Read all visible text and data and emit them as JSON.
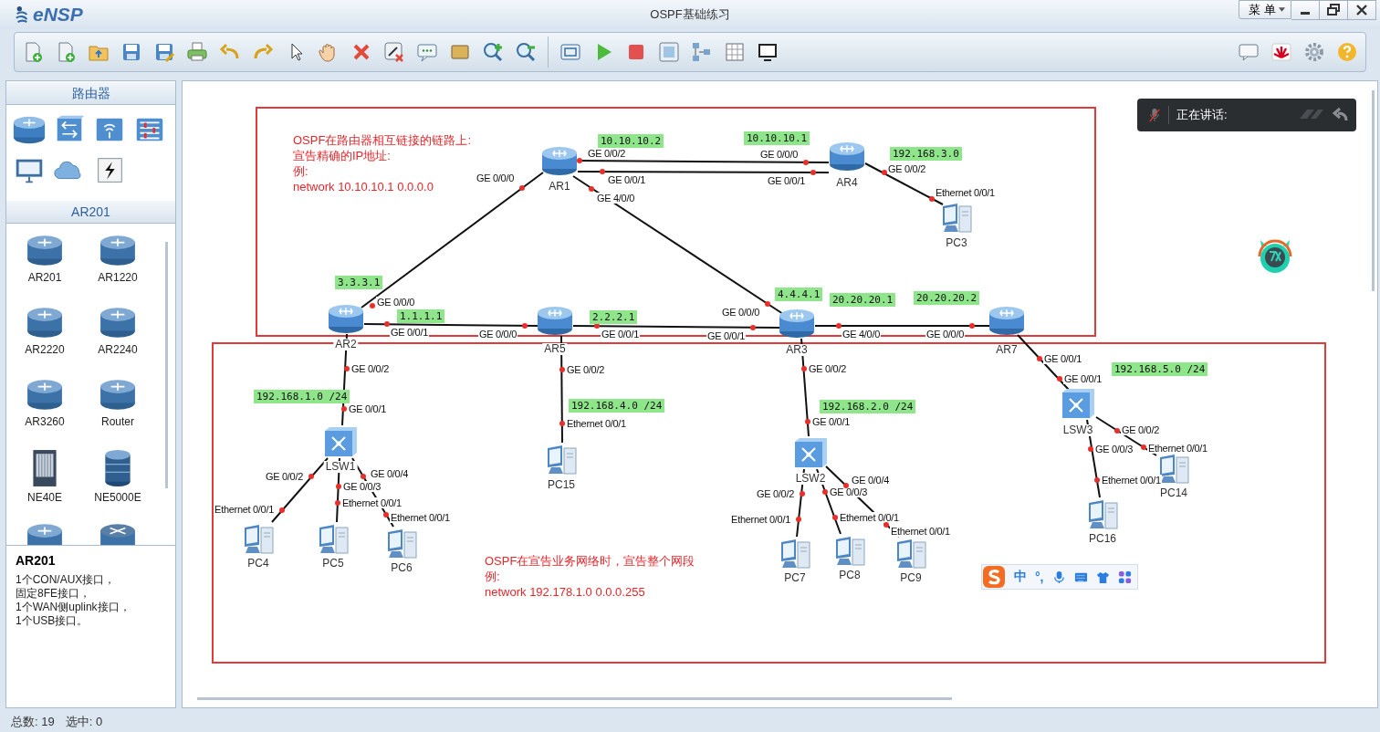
{
  "window": {
    "app": "eNSP",
    "title": "OSPF基础练习",
    "menu": "菜 单"
  },
  "sidebar": {
    "category": "路由器",
    "model": "AR201",
    "devices": [
      {
        "label": "AR201",
        "kind": "router"
      },
      {
        "label": "AR1220",
        "kind": "router"
      },
      {
        "label": "AR2220",
        "kind": "router"
      },
      {
        "label": "AR2240",
        "kind": "router"
      },
      {
        "label": "AR3260",
        "kind": "router"
      },
      {
        "label": "Router",
        "kind": "router"
      },
      {
        "label": "NE40E",
        "kind": "chassis"
      },
      {
        "label": "NE5000E",
        "kind": "core"
      }
    ],
    "info": {
      "title": "AR201",
      "lines": [
        "1个CON/AUX接口，",
        "固定8FE接口，",
        "1个WAN侧uplink接口，",
        "1个USB接口。"
      ]
    }
  },
  "canvas": {
    "notes": [
      {
        "lines": [
          "OSPF在路由器相互链接的链路上:",
          "宣告精确的IP地址:",
          "例:",
          "network 10.10.10.1 0.0.0.0"
        ]
      },
      {
        "lines": [
          "OSPF在宣告业务网络时，宣告整个网段",
          "例:",
          "network 192.178.1.0 0.0.0.255"
        ]
      }
    ],
    "nodes": [
      {
        "label": "AR1",
        "kind": "router"
      },
      {
        "label": "AR4",
        "kind": "router"
      },
      {
        "label": "PC3",
        "kind": "pc"
      },
      {
        "label": "AR2",
        "kind": "router"
      },
      {
        "label": "AR5",
        "kind": "router"
      },
      {
        "label": "AR3",
        "kind": "router"
      },
      {
        "label": "AR7",
        "kind": "router"
      },
      {
        "label": "LSW1",
        "kind": "switch"
      },
      {
        "label": "LSW2",
        "kind": "switch"
      },
      {
        "label": "LSW3",
        "kind": "switch"
      },
      {
        "label": "PC4",
        "kind": "pc"
      },
      {
        "label": "PC5",
        "kind": "pc"
      },
      {
        "label": "PC6",
        "kind": "pc"
      },
      {
        "label": "PC15",
        "kind": "pc"
      },
      {
        "label": "PC7",
        "kind": "pc"
      },
      {
        "label": "PC8",
        "kind": "pc"
      },
      {
        "label": "PC9",
        "kind": "pc"
      },
      {
        "label": "PC16",
        "kind": "pc"
      },
      {
        "label": "PC14",
        "kind": "pc"
      }
    ],
    "links": [
      {
        "ports": [
          "GE 0/0/0",
          "GE 0/0/0"
        ]
      },
      {
        "ports": [
          "GE 0/0/2",
          "GE 0/0/0"
        ]
      },
      {
        "ports": [
          "GE 0/0/1",
          "GE 0/0/1"
        ]
      },
      {
        "ports": [
          "GE 4/0/0",
          "GE 0/0/0"
        ]
      },
      {
        "ports": [
          "GE 0/0/2",
          "Ethernet 0/0/1"
        ]
      },
      {
        "ports": [
          "GE 0/0/1",
          "GE 0/0/0"
        ]
      },
      {
        "ports": [
          "GE 0/0/1",
          "GE 0/0/1"
        ]
      },
      {
        "ports": [
          "GE 4/0/0",
          "GE 0/0/0"
        ]
      },
      {
        "ports": [
          "GE 0/0/2",
          "GE 0/0/1"
        ]
      },
      {
        "ports": [
          "GE 0/0/2",
          "Ethernet 0/0/1"
        ]
      },
      {
        "ports": [
          "GE 0/0/2",
          "GE 0/0/1"
        ]
      },
      {
        "ports": [
          "GE 0/0/1",
          "GE 0/0/1"
        ]
      },
      {
        "ports": [
          "GE 0/0/2",
          "Ethernet 0/0/1"
        ]
      },
      {
        "ports": [
          "GE 0/0/3",
          "Ethernet 0/0/1"
        ]
      },
      {
        "ports": [
          "GE 0/0/4",
          "Ethernet 0/0/1"
        ]
      },
      {
        "ports": [
          "GE 0/0/2",
          "Ethernet 0/0/1"
        ]
      },
      {
        "ports": [
          "GE 0/0/3",
          "Ethernet 0/0/1"
        ]
      },
      {
        "ports": [
          "GE 0/0/4",
          "Ethernet 0/0/1"
        ]
      },
      {
        "ports": [
          "GE 0/0/3",
          "Ethernet 0/0/1"
        ]
      },
      {
        "ports": [
          "GE 0/0/2",
          "Ethernet 0/0/1"
        ]
      }
    ],
    "tags": [
      "10.10.10.2",
      "10.10.10.1",
      "192.168.3.0",
      "3.3.3.1",
      "1.1.1.1",
      "2.2.2.1",
      "4.4.4.1",
      "20.20.20.1",
      "20.20.20.2",
      "192.168.1.0 /24",
      "192.168.4.0 /24",
      "192.168.2.0 /24",
      "192.168.5.0 /24"
    ]
  },
  "voice": {
    "label": "正在讲话:"
  },
  "ime": {
    "mode": "中",
    "punct": "°,"
  },
  "status_bar": {
    "total": "总数: 19",
    "selected": "选中: 0"
  }
}
